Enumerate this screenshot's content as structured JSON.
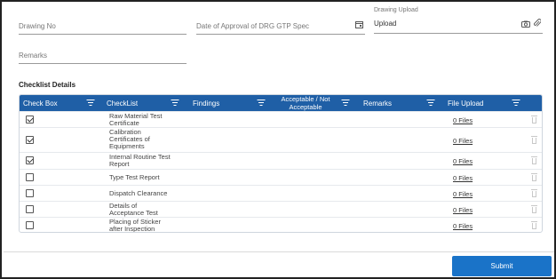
{
  "form": {
    "drawing_no": {
      "placeholder": "Drawing No",
      "value": ""
    },
    "approval_date": {
      "placeholder": "Date of Approval of DRG GTP Spec",
      "icon": "calendar-icon"
    },
    "drawing_upload": {
      "label": "Drawing Upload",
      "value": "Upload",
      "icons": [
        "camera-icon",
        "paperclip-icon"
      ]
    },
    "remarks": {
      "placeholder": "Remarks"
    }
  },
  "checklist": {
    "title": "Checklist Details",
    "columns": [
      {
        "label": "Check Box",
        "filter": true
      },
      {
        "label": "CheckList",
        "filter": true
      },
      {
        "label": "Findings",
        "filter": true
      },
      {
        "label": "Acceptable / Not Acceptable",
        "filter": true
      },
      {
        "label": "Remarks",
        "filter": true
      },
      {
        "label": "File Upload",
        "filter": true
      }
    ],
    "rows": [
      {
        "checked": true,
        "item": "Raw Material Test Certificate",
        "files": "0 Files"
      },
      {
        "checked": true,
        "item": "Calibration Certificates of Equipments",
        "files": "0 Files"
      },
      {
        "checked": true,
        "item": "Internal Routine Test Report",
        "files": "0 Files"
      },
      {
        "checked": false,
        "item": "Type Test Report",
        "files": "0 Files"
      },
      {
        "checked": false,
        "item": "Dispatch Clearance",
        "files": "0 Files"
      },
      {
        "checked": false,
        "item": "Details of Acceptance Test",
        "files": "0 Files"
      },
      {
        "checked": false,
        "item": "Placing of Sticker after Inspection",
        "files": "0 Files"
      }
    ]
  },
  "actions": {
    "submit_label": "Submit"
  },
  "colors": {
    "header_bg": "#1f5fa6",
    "submit_bg": "#1a73c8"
  }
}
